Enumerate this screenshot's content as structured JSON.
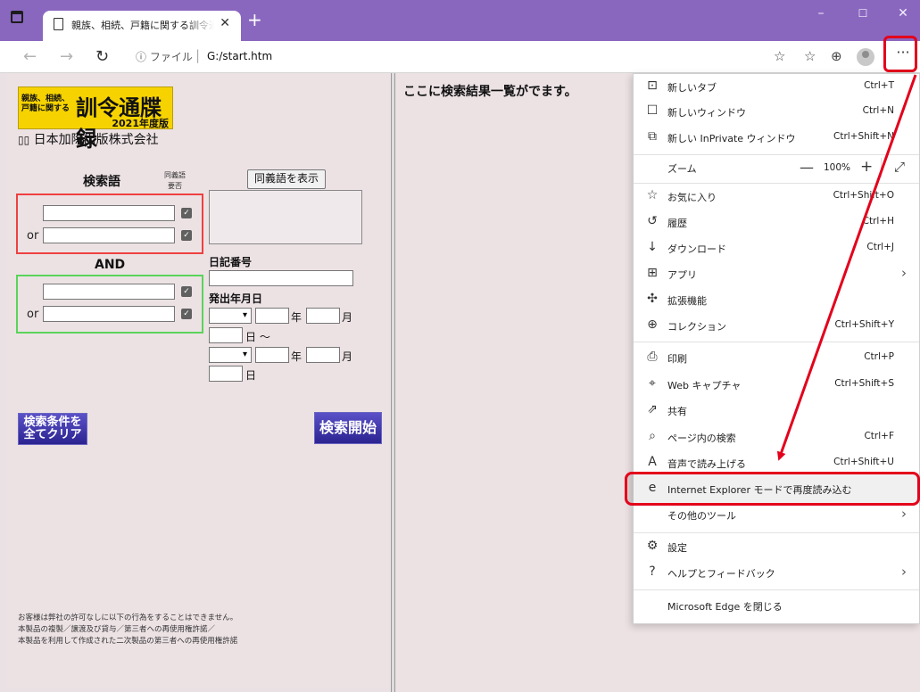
{
  "tab": {
    "title": "親族、相続、戸籍に関する訓令通牒録"
  },
  "address_bar": {
    "site_info": "ⓘ ファイル",
    "url": "G:/start.htm"
  },
  "logo": {
    "line1": "親族、相続、",
    "line2": "戸籍に関する",
    "main": "訓令通牒録",
    "edition": "2021年度版"
  },
  "publisher": "日本加除出版株式会社",
  "form": {
    "keyword_label": "検索語",
    "synonym_note_line1": "同義語",
    "synonym_note_line2": "要否",
    "show_synonyms_button": "同義語を表示",
    "or_label_1": "or",
    "or_label_2": "or",
    "and_label": "AND",
    "diary_number_label": "日記番号",
    "issue_date_label": "発出年月日",
    "year_unit": "年",
    "month_unit": "月",
    "day_unit": "日",
    "range_separator": "〜",
    "clear_button_line1": "検索条件を",
    "clear_button_line2": "全てクリア",
    "search_button": "検索開始"
  },
  "notice": {
    "line1": "お客様は弊社の許可なしに以下の行為をすることはできません。",
    "line2": "本製品の複製／譲渡及び貸与／第三者への再使用権許諾／",
    "line3": "本製品を利用して作成された二次製品の第三者への再使用権許諾"
  },
  "results_heading": "ここに検索結果一覧がでます。",
  "menu": {
    "items": [
      {
        "label": "新しいタブ",
        "shortcut": "Ctrl+T",
        "icon": "new-tab-icon"
      },
      {
        "label": "新しいウィンドウ",
        "shortcut": "Ctrl+N",
        "icon": "new-window-icon"
      },
      {
        "label": "新しい InPrivate ウィンドウ",
        "shortcut": "Ctrl+Shift+N",
        "icon": "inprivate-icon"
      },
      {
        "label": "お気に入り",
        "shortcut": "Ctrl+Shift+O",
        "icon": "favorites-icon"
      },
      {
        "label": "履歴",
        "shortcut": "Ctrl+H",
        "icon": "history-icon"
      },
      {
        "label": "ダウンロード",
        "shortcut": "Ctrl+J",
        "icon": "download-icon"
      },
      {
        "label": "アプリ",
        "shortcut": "",
        "icon": "apps-icon"
      },
      {
        "label": "拡張機能",
        "shortcut": "",
        "icon": "extensions-icon"
      },
      {
        "label": "コレクション",
        "shortcut": "Ctrl+Shift+Y",
        "icon": "collections-icon"
      },
      {
        "label": "印刷",
        "shortcut": "Ctrl+P",
        "icon": "print-icon"
      },
      {
        "label": "Web キャプチャ",
        "shortcut": "Ctrl+Shift+S",
        "icon": "web-capture-icon"
      },
      {
        "label": "共有",
        "shortcut": "",
        "icon": "share-icon"
      },
      {
        "label": "ページ内の検索",
        "shortcut": "Ctrl+F",
        "icon": "find-icon"
      },
      {
        "label": "音声で読み上げる",
        "shortcut": "Ctrl+Shift+U",
        "icon": "read-aloud-icon"
      },
      {
        "label": "Internet Explorer モードで再度読み込む",
        "shortcut": "",
        "icon": "ie-mode-icon"
      },
      {
        "label": "その他のツール",
        "shortcut": "",
        "icon": ""
      },
      {
        "label": "設定",
        "shortcut": "",
        "icon": "settings-icon"
      },
      {
        "label": "ヘルプとフィードバック",
        "shortcut": "",
        "icon": "help-icon"
      },
      {
        "label": "Microsoft Edge を閉じる",
        "shortcut": "",
        "icon": ""
      }
    ],
    "zoom": {
      "label": "ズーム",
      "value": "100%"
    }
  },
  "colors": {
    "title_bar": "#8a67bf",
    "page_background": "#ece2e4",
    "highlight_red": "#e3001b",
    "group_red_border": "#ee4040",
    "group_green_border": "#5ad45a",
    "logo_yellow": "#f6d300",
    "image_button_blue": "#2b2490"
  }
}
